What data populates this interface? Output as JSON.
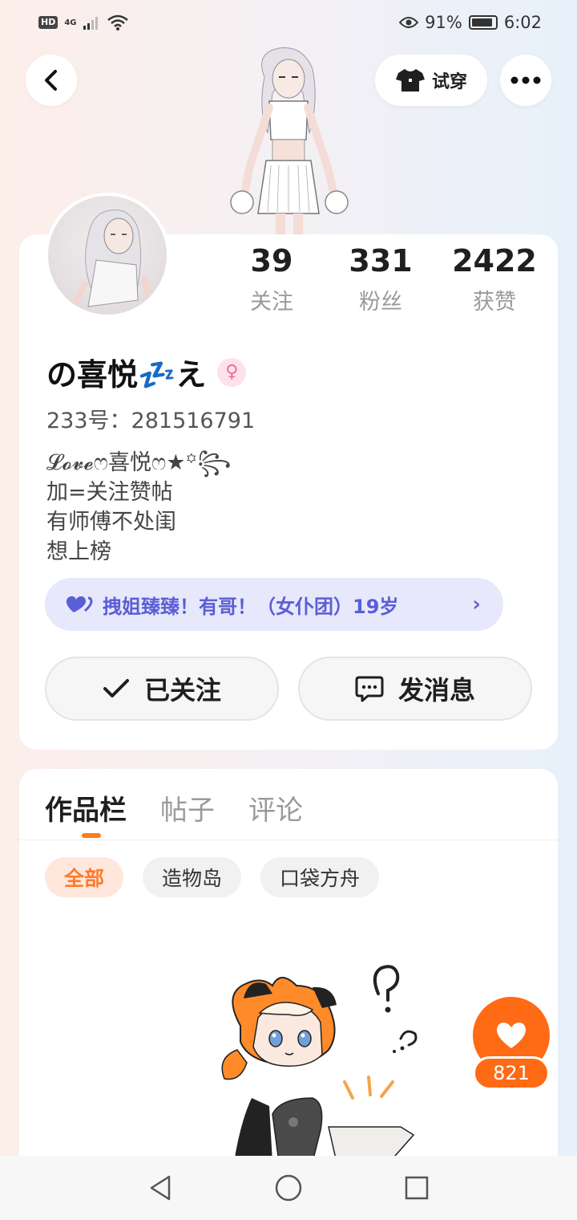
{
  "status_bar": {
    "hd": "HD",
    "network": "4G",
    "battery_percent": "91%",
    "battery_level": 0.91,
    "time": "6:02"
  },
  "header": {
    "try_on_label": "试穿",
    "icons": [
      "back-icon",
      "shirt-icon",
      "more-icon"
    ]
  },
  "profile": {
    "stats": [
      {
        "value": "39",
        "label": "关注"
      },
      {
        "value": "331",
        "label": "粉丝"
      },
      {
        "value": "2422",
        "label": "获赞"
      }
    ],
    "nickname": "の喜悦💤え",
    "gender_symbol": "♀",
    "uid": "233号：281516791",
    "bio_lines": [
      "𝓛𝓸𝓿𝓮ෆ喜悦ෆ★꙳꧂",
      "加=关注赞帖",
      "有师傅不处闺",
      "想上榜"
    ],
    "group": {
      "label": "拽姐臻臻！有哥！（女仆团）19岁",
      "chevron": "›"
    },
    "follow_label": "已关注",
    "message_label": "发消息"
  },
  "works": {
    "tabs": [
      {
        "label": "作品栏",
        "active": true
      },
      {
        "label": "帖子",
        "active": false
      },
      {
        "label": "评论",
        "active": false
      }
    ],
    "chips": [
      {
        "label": "全部",
        "active": true
      },
      {
        "label": "造物岛",
        "active": false
      },
      {
        "label": "口袋方舟",
        "active": false
      }
    ]
  },
  "like": {
    "count": "821"
  },
  "colors": {
    "accent": "#ff6a14",
    "group_text": "#5b5ed4",
    "group_bg": "#e7e8fb"
  }
}
